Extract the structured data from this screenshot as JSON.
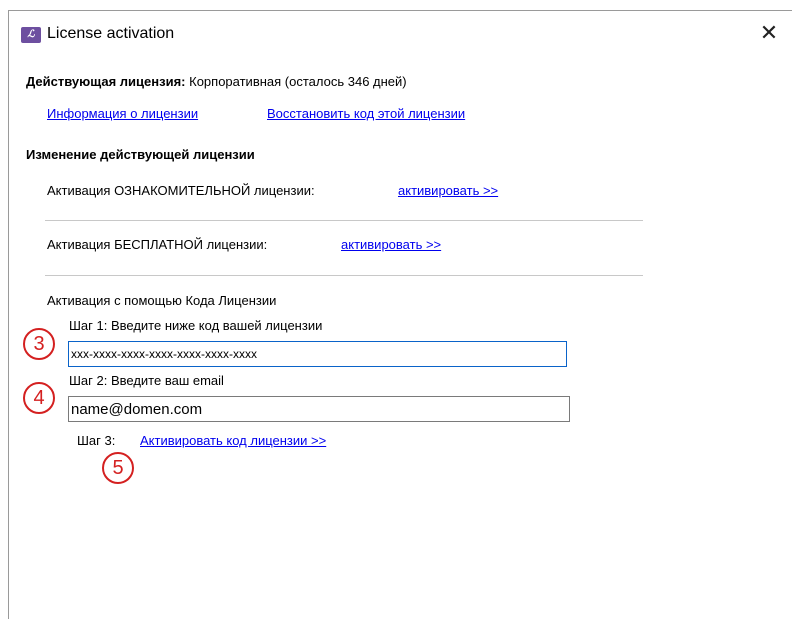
{
  "window": {
    "title": "License activation",
    "icon": "app-logo-icon",
    "close_glyph": "✕"
  },
  "current_license": {
    "label": "Действующая лицензия:",
    "value": "Корпоративная (осталось 346 дней)",
    "info_link": "Информация о лицензии",
    "restore_link": "Восстановить код этой лицензии"
  },
  "change_section": {
    "heading": "Изменение действующей лицензии",
    "trial_label": "Активация ОЗНАКОМИТЕЛЬНОЙ лицензии:",
    "trial_link": "активировать >>",
    "free_label": "Активация БЕСПЛАТНОЙ лицензии:",
    "free_link": "активировать >>"
  },
  "code_section": {
    "heading": "Активация с помощью Кода Лицензии",
    "step1_label": "Шаг 1: Введите ниже код вашей лицензии",
    "code_value": "xxx-xxxx-xxxx-xxxx-xxxx-xxxx-xxxx",
    "step2_label": "Шаг 2: Введите ваш email",
    "email_value": "name@domen.com",
    "step3_label": "Шаг 3:",
    "activate_link": "Активировать код лицензии >>"
  },
  "annotations": {
    "badge_3": "3",
    "badge_4": "4",
    "badge_5": "5",
    "color": "#d42020"
  },
  "colors": {
    "link": "#0000ee",
    "focus_border": "#0a63c9"
  }
}
